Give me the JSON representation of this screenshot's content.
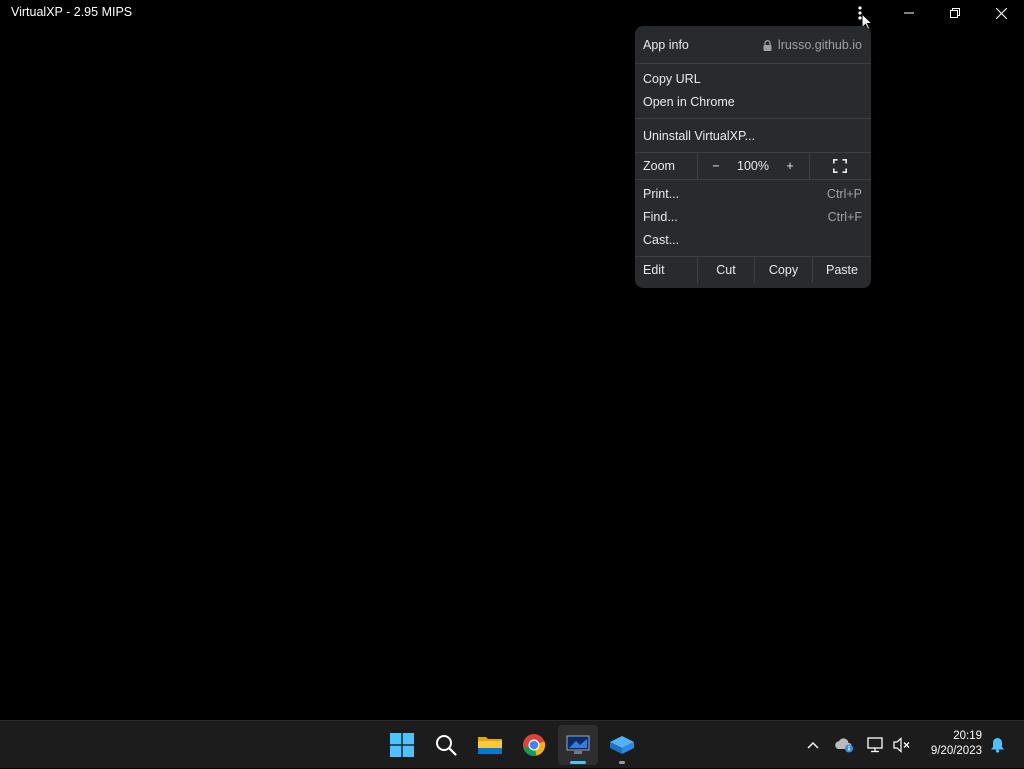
{
  "window": {
    "title": "VirtualXP - 2.95 MIPS"
  },
  "menu": {
    "app_info": "App info",
    "site": "lrusso.github.io",
    "copy_url": "Copy URL",
    "open_in_chrome": "Open in Chrome",
    "uninstall": "Uninstall VirtualXP...",
    "zoom_label": "Zoom",
    "zoom_minus": "−",
    "zoom_value": "100%",
    "zoom_plus": "+",
    "print": "Print...",
    "print_shortcut": "Ctrl+P",
    "find": "Find...",
    "find_shortcut": "Ctrl+F",
    "cast": "Cast...",
    "edit_label": "Edit",
    "cut": "Cut",
    "copy": "Copy",
    "paste": "Paste"
  },
  "taskbar": {
    "apps": [
      "start-icon",
      "search-icon",
      "file-explorer-icon",
      "chrome-icon",
      "virtualxp-icon",
      "app-icon"
    ],
    "time": "20:19",
    "date": "9/20/2023"
  },
  "colors": {
    "menu_bg": "#292a2d",
    "taskbar_bg": "#1c1c1c",
    "accent": "#4cc2ff"
  }
}
